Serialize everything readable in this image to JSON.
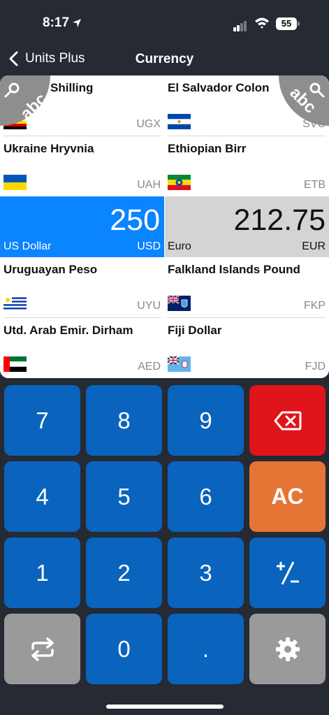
{
  "status_bar": {
    "time": "8:17",
    "battery": "55"
  },
  "nav": {
    "back_label": "Units Plus",
    "title": "Currency"
  },
  "left_column": [
    {
      "name": "Shilling",
      "code": "UGX",
      "flag": "uganda"
    },
    {
      "name": "Ukraine Hryvnia",
      "code": "UAH",
      "flag": "ukraine"
    },
    {
      "name": "Uruguayan Peso",
      "code": "UYU",
      "flag": "uruguay"
    },
    {
      "name": "Utd. Arab Emir. Dirham",
      "code": "AED",
      "flag": "uae"
    }
  ],
  "right_column": [
    {
      "name": "El Salvador Colon",
      "code": "SVC",
      "flag": "el-salvador"
    },
    {
      "name": "Ethiopian Birr",
      "code": "ETB",
      "flag": "ethiopia"
    },
    {
      "name": "Falkland Islands Pound",
      "code": "FKP",
      "flag": "falkland"
    },
    {
      "name": "Fiji Dollar",
      "code": "FJD",
      "flag": "fiji"
    }
  ],
  "active_from": {
    "value": "250",
    "name": "US Dollar",
    "code": "USD"
  },
  "active_to": {
    "value": "212.75",
    "name": "Euro",
    "code": "EUR"
  },
  "search_badge": {
    "text": "abc"
  },
  "keypad": {
    "row1": [
      "7",
      "8",
      "9"
    ],
    "row2": [
      "4",
      "5",
      "6"
    ],
    "row3": [
      "1",
      "2",
      "3"
    ],
    "row4_zero": "0",
    "row4_dot": ".",
    "clear_label": "AC"
  },
  "colors": {
    "background": "#252a33",
    "active_from": "#0a84ff",
    "active_to": "#d4d4d4",
    "key_blue": "#0a63bd",
    "key_delete": "#e0141a",
    "key_clear": "#e57535",
    "key_gray": "#9a9a9a"
  }
}
